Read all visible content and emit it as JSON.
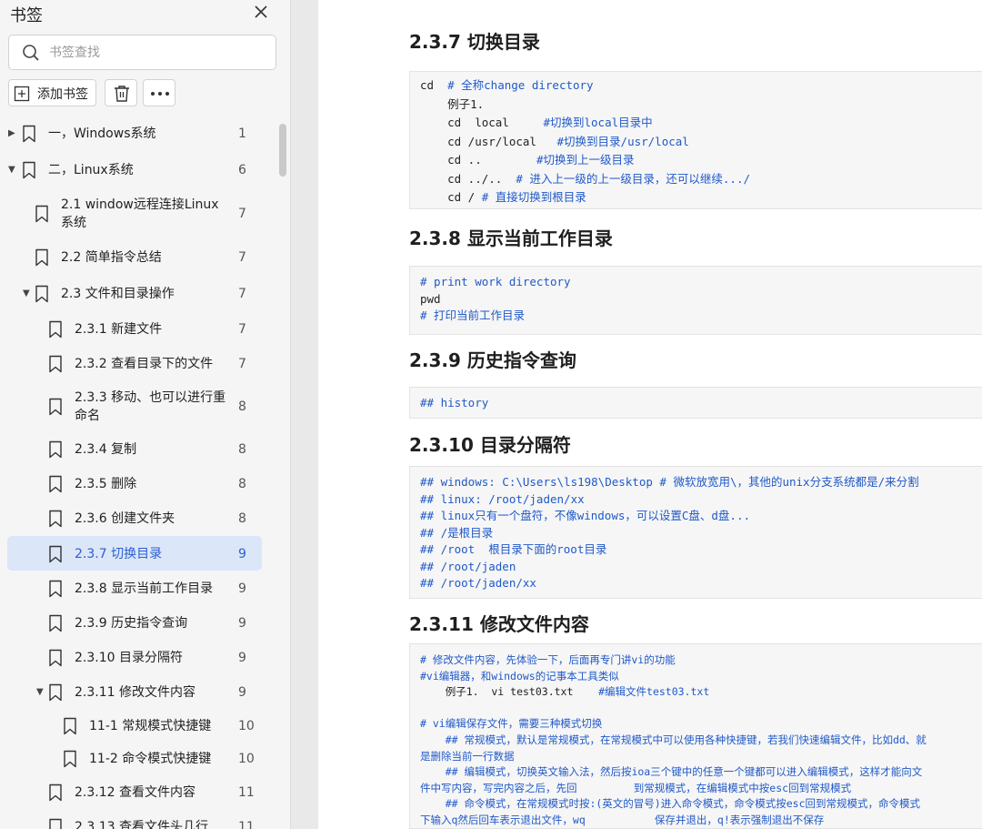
{
  "sidebar": {
    "title": "书签",
    "close_icon": "close-icon",
    "search": {
      "placeholder": "书签查找",
      "value": ""
    },
    "toolbar": {
      "add_label": "添加书签",
      "delete_icon": "trash-icon",
      "more_icon": "more-icon"
    },
    "items": [
      {
        "label": "一，Windows系统",
        "page": "1",
        "caret": "collapsed"
      },
      {
        "label": "二，Linux系统",
        "page": "6",
        "caret": "expanded"
      },
      {
        "label": "2.1 window远程连接Linux",
        "label2": "系统",
        "page": "7"
      },
      {
        "label": "2.2 简单指令总结",
        "page": "7"
      },
      {
        "label": "2.3 文件和目录操作",
        "page": "7",
        "caret": "expanded"
      },
      {
        "label": "2.3.1 新建文件",
        "page": "7"
      },
      {
        "label": "2.3.2 查看目录下的文件",
        "page": "7"
      },
      {
        "label": "2.3.3 移动、也可以进行重",
        "label2": "命名",
        "page": "8"
      },
      {
        "label": "2.3.4 复制",
        "page": "8"
      },
      {
        "label": "2.3.5 删除",
        "page": "8"
      },
      {
        "label": "2.3.6 创建文件夹",
        "page": "8"
      },
      {
        "label": "2.3.7 切换目录",
        "page": "9",
        "active": true
      },
      {
        "label": "2.3.8 显示当前工作目录",
        "page": "9"
      },
      {
        "label": "2.3.9 历史指令查询",
        "page": "9"
      },
      {
        "label": "2.3.10 目录分隔符",
        "page": "9"
      },
      {
        "label": "2.3.11 修改文件内容",
        "page": "9",
        "caret": "expanded"
      },
      {
        "label": "11-1 常规模式快捷键",
        "page": "10"
      },
      {
        "label": "11-2 命令模式快捷键",
        "page": "10"
      },
      {
        "label": "2.3.12 查看文件内容",
        "page": "11"
      },
      {
        "label": "2.3.13 查看文件头几行",
        "page": "11"
      }
    ]
  },
  "doc": {
    "sections": [
      {
        "heading": "2.3.7 切换目录",
        "lines": [
          {
            "a": "cd  ",
            "b": "# 全称change directory"
          },
          {
            "a": "    例子1."
          },
          {
            "a": "    cd  local     ",
            "b": "#切换到local目录中"
          },
          {
            "a": "    cd /usr/local   ",
            "b": "#切换到目录/usr/local"
          },
          {
            "a": "    cd ..        ",
            "b": "#切换到上一级目录"
          },
          {
            "a": "    cd ../..  ",
            "b": "# 进入上一级的上一级目录，还可以继续.../"
          },
          {
            "a": "    cd / ",
            "b": "# 直接切换到根目录"
          }
        ]
      },
      {
        "heading": "2.3.8 显示当前工作目录",
        "lines": [
          {
            "b": "# print work directory"
          },
          {
            "a": "pwd"
          },
          {
            "b": "# 打印当前工作目录"
          }
        ]
      },
      {
        "heading": "2.3.9 历史指令查询",
        "lines": [
          {
            "b": "## history"
          }
        ]
      },
      {
        "heading": "2.3.10 目录分隔符",
        "lines": [
          {
            "b": "## windows: C:\\Users\\ls198\\Desktop # 微软放宽用\\，其他的unix分支系统都是/来分割"
          },
          {
            "b": "## linux: /root/jaden/xx"
          },
          {
            "b": "## linux只有一个盘符，不像windows，可以设置C盘、d盘..."
          },
          {
            "b": "## /是根目录"
          },
          {
            "b": "## /root  根目录下面的root目录"
          },
          {
            "b": "## /root/jaden"
          },
          {
            "b": "## /root/jaden/xx"
          }
        ]
      },
      {
        "heading": "2.3.11 修改文件内容",
        "lines": [
          {
            "b": "# 修改文件内容，先体验一下，后面再专门讲vi的功能"
          },
          {
            "b": "#vi编辑器，和windows的记事本工具类似"
          },
          {
            "a": "    例子1.  vi test03.txt    ",
            "b": "#编辑文件test03.txt"
          },
          {
            "a": ""
          },
          {
            "b": "# vi编辑保存文件，需要三种模式切换"
          },
          {
            "b": "    ## 常规模式，默认是常规模式，在常规模式中可以使用各种快捷键，若我们快速编辑文件，比如dd、就"
          },
          {
            "b": "是删除当前一行数据"
          },
          {
            "b": "    ## 编辑模式，切换英文输入法，然后按ioa三个键中的任意一个键都可以进入编辑模式，这样才能向文"
          },
          {
            "b": "件中写内容，写完内容之后，先回         到常规模式，在编辑模式中按esc回到常规模式"
          },
          {
            "b": "    ## 命令模式，在常规模式时按:(英文的冒号)进入命令模式，命令模式按esc回到常规模式，命令模式"
          },
          {
            "b": "下输入q然后回车表示退出文件，wq           保存并退出，q!表示强制退出不保存"
          }
        ]
      }
    ]
  },
  "colors": {
    "accent": "#2c5fd3",
    "comment": "#2059c8",
    "active_bg": "#dbe6f8"
  }
}
